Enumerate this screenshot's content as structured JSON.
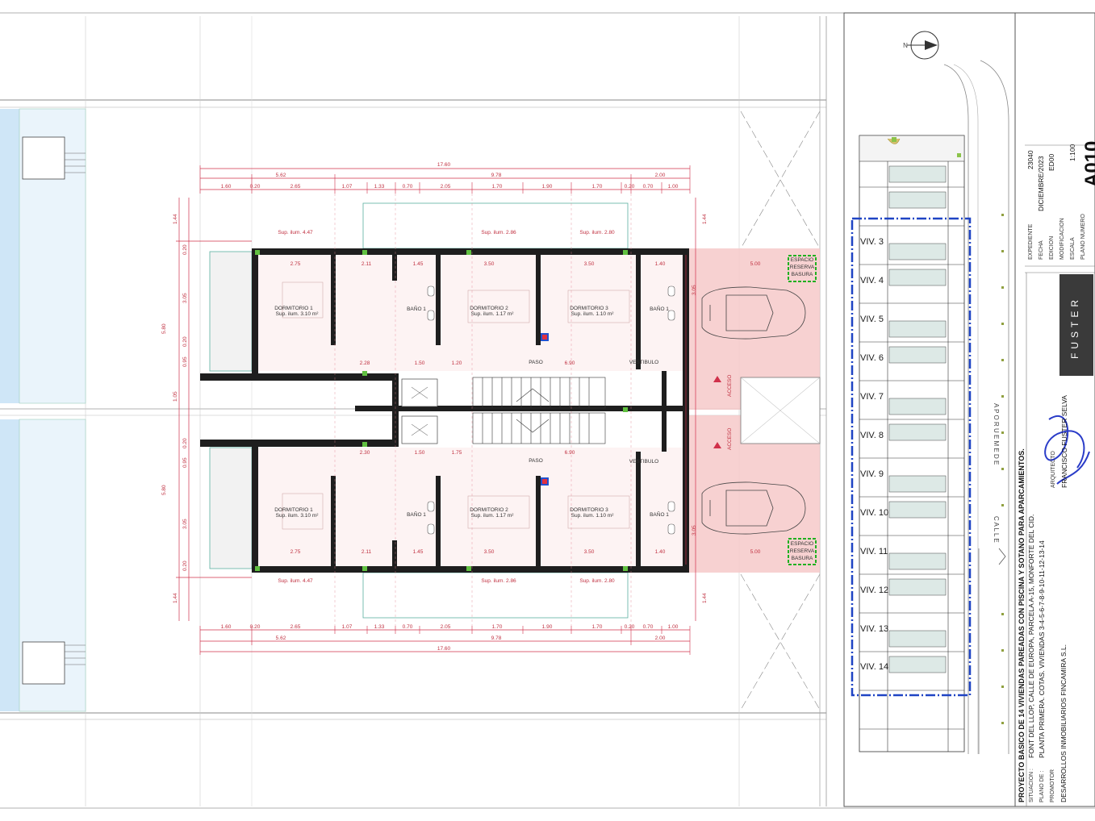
{
  "plan": {
    "top_total": "17.60",
    "top_sub": [
      "5.62",
      "9.78",
      "2.00"
    ],
    "top_row": [
      "1.60",
      "0.20",
      "2.65",
      "1.07",
      "1.33",
      "0.70",
      "2.05",
      "1.70",
      "1.90",
      "1.70",
      "0.20",
      "0.70",
      "1.00"
    ],
    "bottom_total": "17.60",
    "bottom_sub": [
      "5.62",
      "9.78",
      "2.00"
    ],
    "bottom_row": [
      "1.60",
      "0.20",
      "2.65",
      "1.07",
      "1.33",
      "0.70",
      "2.05",
      "1.70",
      "1.90",
      "1.70",
      "0.20",
      "0.70",
      "1.00"
    ],
    "left_dims": [
      "1.44",
      "0.20",
      "3.05",
      "5.80",
      "0.20",
      "0.95",
      "1.05",
      "0.20",
      "0.95",
      "3.05",
      "5.80",
      "0.20",
      "1.44"
    ],
    "rooms_upper": [
      {
        "name": "DORMITORIO 1",
        "area": "Sup. ilum. 3.10 m²"
      },
      {
        "name": "BAÑO 1",
        "area": ""
      },
      {
        "name": "DORMITORIO 2",
        "area": "Sup. ilum. 1.17 m²"
      },
      {
        "name": "DORMITORIO 3",
        "area": "Sup. ilum. 1.10 m²"
      },
      {
        "name": "BAÑO 1",
        "area": ""
      }
    ],
    "rooms_lower": [
      {
        "name": "DORMITORIO 1",
        "area": "Sup. ilum. 3.10 m²"
      },
      {
        "name": "BAÑO 1",
        "area": ""
      },
      {
        "name": "DORMITORIO 2",
        "area": "Sup. ilum. 1.17 m²"
      },
      {
        "name": "DORMITORIO 3",
        "area": "Sup. ilum. 1.10 m²"
      },
      {
        "name": "BAÑO 1",
        "area": ""
      }
    ],
    "paso": "PASO",
    "vestibulo": "VESTIBULO",
    "acceso": "ACCESO",
    "basura": [
      "ESPACIO",
      "RESERVA",
      "BASURA"
    ],
    "interior_dims_upper": [
      "2.75",
      "2.11",
      "1.45",
      "3.50",
      "3.50",
      "1.40",
      "5.00",
      "2.28",
      "1.50",
      "1.20",
      "6.90"
    ],
    "interior_dims_lower": [
      "2.75",
      "2.11",
      "1.45",
      "3.50",
      "3.50",
      "1.40",
      "5.00",
      "2.30",
      "1.50",
      "1.75",
      "6.90"
    ],
    "sup_ilum": [
      "Sup. ilum. 4.47",
      "Sup. ilum. 2.86",
      "Sup. ilum. 2.80"
    ]
  },
  "site": {
    "north": "N",
    "units": [
      "VIV. 3",
      "VIV. 4",
      "VIV. 5",
      "VIV. 6",
      "VIV. 7",
      "VIV. 8",
      "VIV. 9",
      "VIV. 10",
      "VIV. 11",
      "VIV. 12",
      "VIV. 13",
      "VIV. 14"
    ],
    "street_top": "A P O R U E M E D E",
    "street_bottom": "C A L L E"
  },
  "title_block": {
    "proyecto": "PROYECTO BASICO DE 14 VIVIENDAS PAREADAS CON PISCINA Y SOTANO PARA APARCAMIENTOS.",
    "situacion_label": "SITUACION :",
    "situacion": "FONT DEL LLOP, CALLE DE EUROPA, PARCELA A-15, MONFORTE DEL CID.",
    "plano_label": "PLANO DE :",
    "plano": "PLANTA PRIMERA. COTAS. VIVIENDAS 3-4-5-6-7-8-9-10-11-12-13-14",
    "promotor_label": "PROMOTOR",
    "promotor": "DESARROLLOS INMOBILIARIOS FINCAMIRA S.L.",
    "arquitecto_label": "ARQUITECTO",
    "arquitecto": "FRANCISCO FUSTER SELVA",
    "expediente_label": "EXPEDIENTE",
    "expediente": "23040",
    "fecha_label": "FECHA",
    "fecha": "DICIEMBRE/2023",
    "edicion_label": "EDICION",
    "edicion": "ED00",
    "modificacion_label": "MODIFICACION",
    "escala_label": "ESCALA",
    "escala": "1:100",
    "plano_numero_label": "PLANO NUMERO",
    "plano_numero": "A010",
    "logo": "FUSTER"
  },
  "colors": {
    "dim_red": "#d0304a",
    "pool_blue": "#cfe6f7",
    "patio_pink": "#f6c9c9",
    "wall": "#1e1e1e",
    "frame_blue": "#1f44c4",
    "bin_green": "#20b020"
  }
}
